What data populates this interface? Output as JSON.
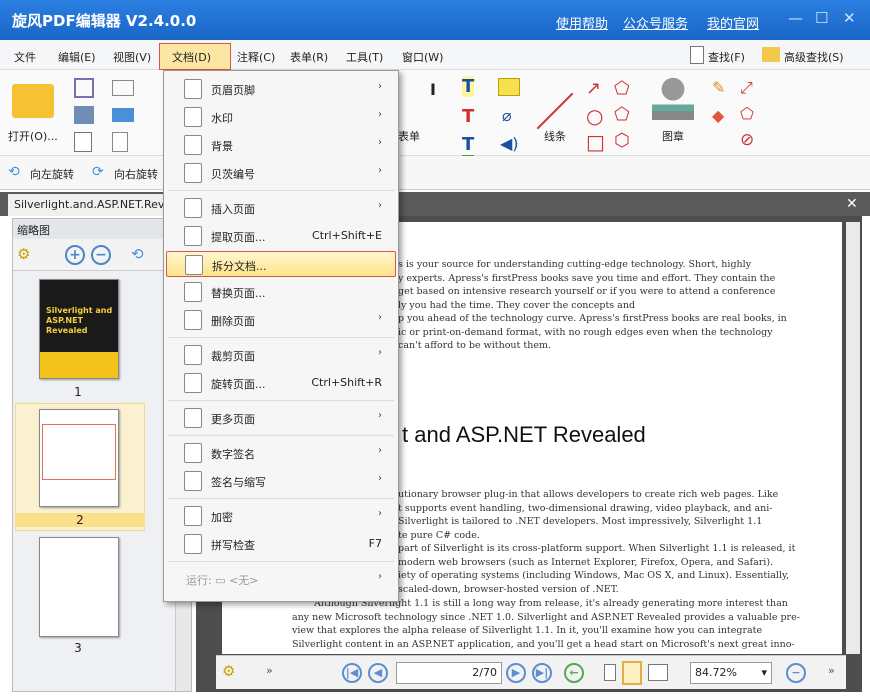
{
  "titlebar": {
    "title": "旋风PDF编辑器 V2.4.0.0",
    "links": [
      "使用帮助",
      "公众号服务",
      "我的官网"
    ],
    "accent": "#1e6fd0"
  },
  "menubar": {
    "items": [
      "文件",
      "编辑(E)",
      "视图(V)",
      "文档(D)",
      "注释(C)",
      "表单(R)",
      "工具(T)",
      "窗口(W)"
    ],
    "find": "查找(F)",
    "advanced_find": "高级查找(S)"
  },
  "ribbon": {
    "open": "打开(O)...",
    "form": "表单",
    "line": "线条",
    "stamp": "图章"
  },
  "rotate": {
    "left": "向左旋转",
    "right": "向右旋转"
  },
  "doc_tab": {
    "title": "Silverlight.and.ASP.NET.Reve"
  },
  "left_panel": {
    "title": "缩略图",
    "pages": [
      "1",
      "2",
      "3"
    ],
    "selected_page": 2,
    "thumb1_title": "Silverlight and ASP.NET Revealed"
  },
  "document": {
    "upper_lines": [
      "s is your source for understanding cutting-edge technology. Short, highly",
      "y experts. Apress's firstPress books save you time and effort. They contain the",
      "get based on intensive research yourself or if you were to attend a conference",
      "ly you had the time. They cover the concepts and",
      "p you ahead of the technology curve. Apress's firstPress books are real books, in",
      "ic or print-on-demand format, with no rough edges even when the technology",
      "can't afford to be without them."
    ],
    "heading": "t and ASP.NET Revealed",
    "middle_lines": [
      "utionary browser plug-in that allows developers to create rich web pages. Like",
      "t supports event handling, two-dimensional drawing, video playback, and ani-",
      "Silverlight is tailored to .NET developers. Most impressively, Silverlight 1.1",
      "te pure C# code.",
      "part of Silverlight is its cross-platform support. When Silverlight 1.1 is released, it",
      "modern web browsers (such as Internet Explorer, Firefox, Opera, and Safari).",
      "iety of operating systems (including Windows, Mac OS X, and Linux). Essentially,",
      "scaled-down, browser-hosted version of .NET."
    ],
    "lower_lines": [
      "Although Silverlight 1.1 is still a long way from release, it's already generating more interest than",
      "any new Microsoft technology since .NET 1.0. Silverlight and ASP.NET Revealed provides a valuable pre-",
      "view that explores the alpha release of Silverlight 1.1. In it, you'll examine how you can integrate",
      "Silverlight content in an ASP.NET application, and you'll get a head start on Microsoft's next great inno-"
    ]
  },
  "bottombar": {
    "page": "2/70",
    "zoom": "84.72%"
  },
  "doc_menu": {
    "items": [
      {
        "label": "页眉页脚",
        "arrow": "›",
        "icon": "header-footer-icon"
      },
      {
        "label": "水印",
        "arrow": "›",
        "icon": "watermark-icon"
      },
      {
        "label": "背景",
        "arrow": "›",
        "icon": "background-icon"
      },
      {
        "label": "贝茨编号",
        "arrow": "›",
        "icon": "bates-number-icon"
      },
      {
        "label": "插入页面",
        "arrow": "›",
        "icon": "insert-page-icon"
      },
      {
        "label": "提取页面...",
        "shortcut": "Ctrl+Shift+E",
        "icon": "extract-page-icon"
      },
      {
        "label": "拆分文档...",
        "icon": "split-document-icon",
        "highlighted": true
      },
      {
        "label": "替换页面...",
        "icon": "replace-page-icon"
      },
      {
        "label": "删除页面",
        "arrow": "›",
        "icon": "delete-page-icon"
      },
      {
        "label": "裁剪页面",
        "arrow": "›",
        "icon": "crop-page-icon"
      },
      {
        "label": "旋转页面...",
        "shortcut": "Ctrl+Shift+R",
        "icon": "rotate-page-icon"
      },
      {
        "label": "更多页面",
        "arrow": "›",
        "icon": "more-pages-icon"
      },
      {
        "label": "数字签名",
        "arrow": "›",
        "icon": "digital-signature-icon"
      },
      {
        "label": "签名与缩写",
        "arrow": "›",
        "icon": "sign-initial-icon"
      },
      {
        "label": "加密",
        "arrow": "›",
        "icon": "encrypt-icon"
      },
      {
        "label": "拼写检查",
        "shortcut": "F7",
        "icon": "spell-check-icon"
      },
      {
        "label": "运行: ▭ <无>",
        "arrow": "›",
        "disabled": true
      }
    ]
  }
}
